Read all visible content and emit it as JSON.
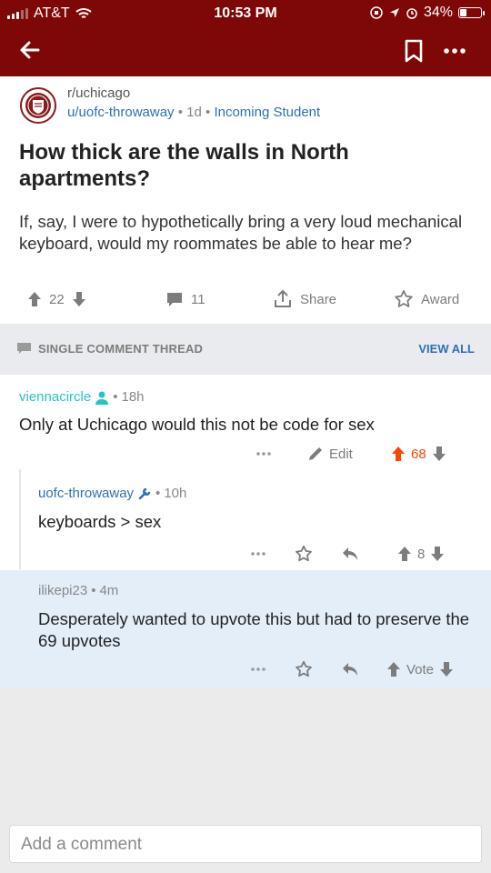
{
  "status_bar": {
    "carrier": "AT&T",
    "time": "10:53 PM",
    "battery": "34%",
    "battery_level": 0.34
  },
  "post": {
    "subreddit": "r/uchicago",
    "author": "u/uofc-throwaway",
    "age": "1d",
    "flair": "Incoming Student",
    "title": "How thick are the walls in North apartments?",
    "body": "If, say, I were to hypothetically bring a very loud mechanical keyboard, would my roommates be able to hear me?",
    "score": "22",
    "comments": "11",
    "share_label": "Share",
    "award_label": "Award"
  },
  "thread_bar": {
    "label": "SINGLE COMMENT THREAD",
    "view_all": "VIEW ALL"
  },
  "comments": [
    {
      "author": "viennacircle",
      "age": "18h",
      "text": "Only at Uchicago would this not be code for sex",
      "edit_label": "Edit",
      "score": "68"
    },
    {
      "author": "uofc-throwaway",
      "age": "10h",
      "text": "keyboards > sex",
      "score": "8"
    },
    {
      "author": "ilikepi23",
      "age": "4m",
      "text": "Desperately wanted to upvote this but had to preserve the 69 upvotes",
      "vote_label": "Vote"
    }
  ],
  "composer": {
    "placeholder": "Add a comment"
  },
  "colors": {
    "header": "#7e0708",
    "accent_blue": "#2f6fb5",
    "upvote_orange": "#ff4500",
    "op_teal": "#27c3c3",
    "highlight": "#e4eef9"
  },
  "icons": [
    "back-arrow-icon",
    "bookmark-icon",
    "more-icon",
    "upvote-icon",
    "downvote-icon",
    "comment-icon",
    "share-icon",
    "award-icon",
    "edit-icon",
    "reply-icon",
    "user-icon",
    "wrench-icon"
  ]
}
